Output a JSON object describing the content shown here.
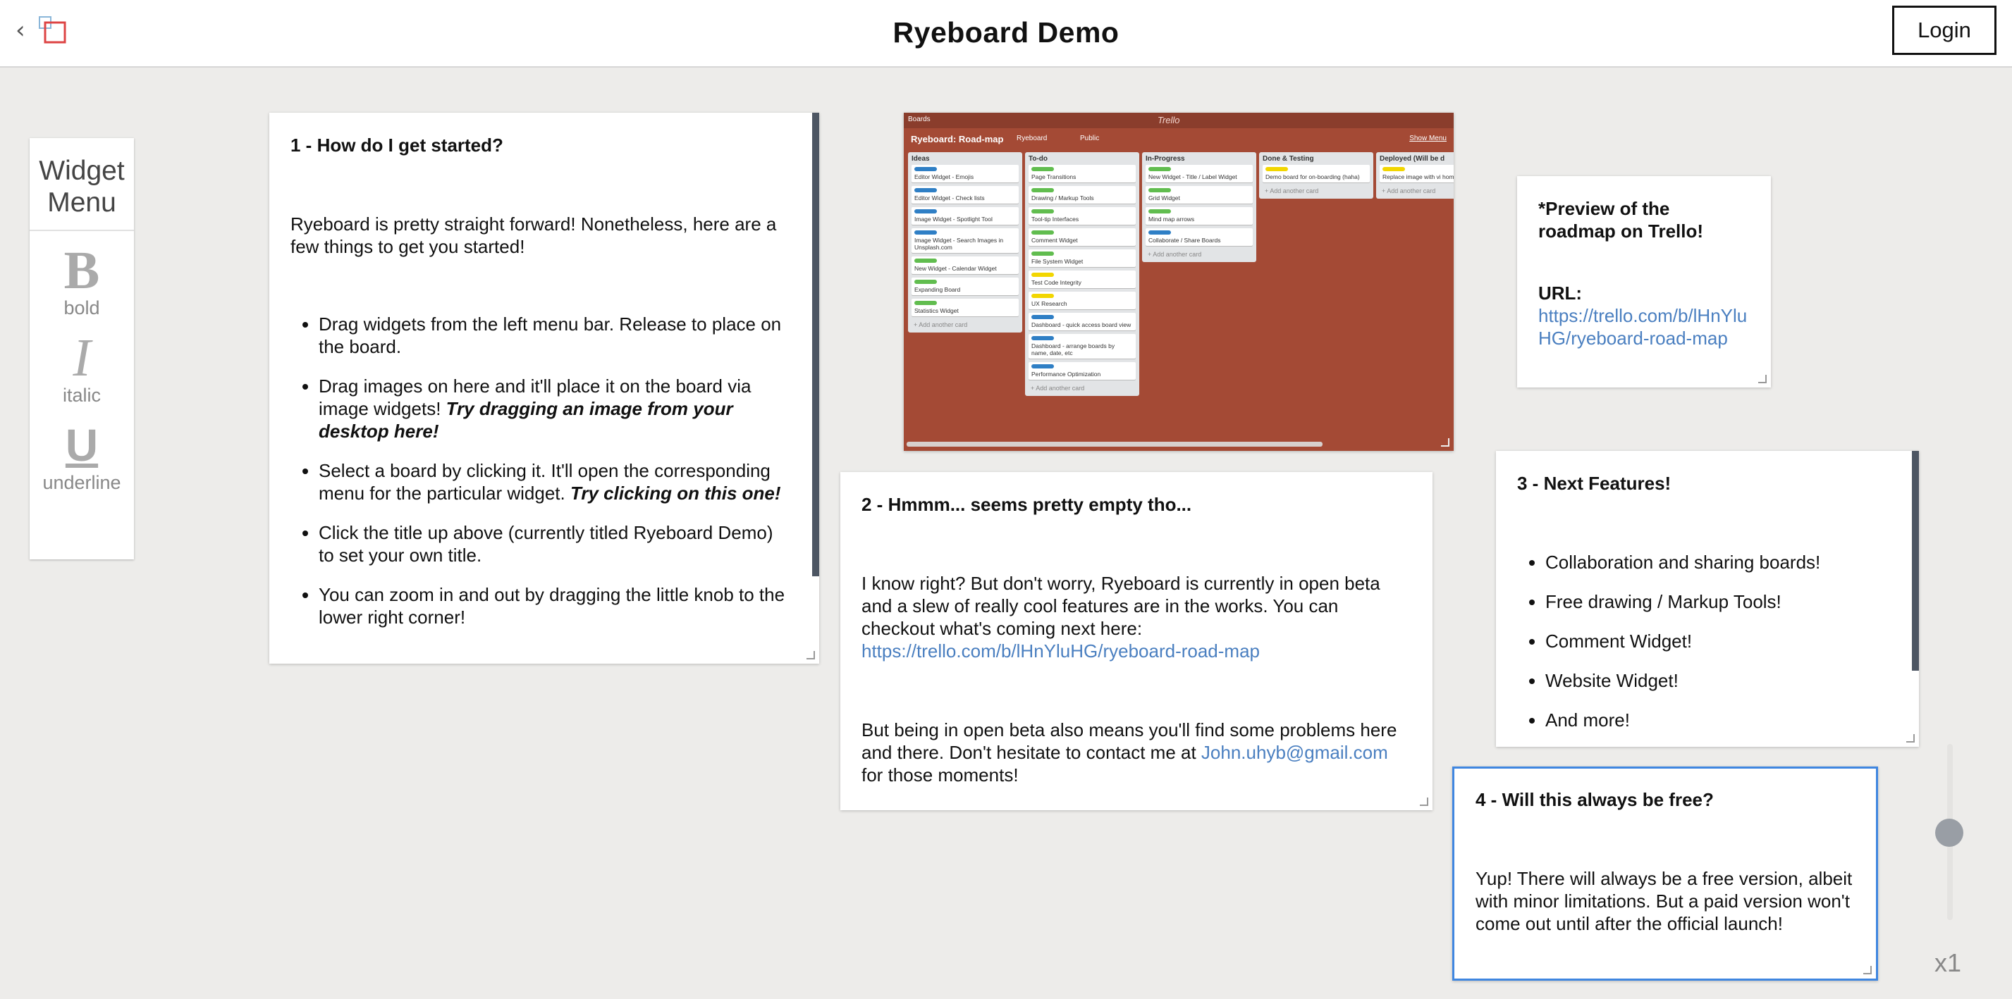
{
  "header": {
    "title": "Ryeboard Demo",
    "login_label": "Login",
    "back_icon": "chevron-left-icon",
    "logo_icon": "ryeboard-logo-icon"
  },
  "widget_menu": {
    "title": "Widget Menu",
    "tools": [
      {
        "glyph": "B",
        "label": "bold"
      },
      {
        "glyph": "I",
        "label": "italic"
      },
      {
        "glyph": "U",
        "label": "underline"
      }
    ]
  },
  "card1": {
    "heading": "1 - How do I get started?",
    "intro": "Ryeboard is pretty straight forward! Nonetheless, here are a few things to get you started!",
    "items": [
      {
        "text": "Drag widgets from the left menu bar. Release to place on the board.",
        "em": ""
      },
      {
        "text": "Drag images on here and it'll place it on the board via image widgets! ",
        "em": "Try dragging an image from your desktop here!"
      },
      {
        "text": "Select a board by clicking it. It'll open the corresponding menu for the particular widget. ",
        "em": "Try clicking on this one!"
      },
      {
        "text": "Click the title up above (currently titled Ryeboard Demo) to set your own title.",
        "em": ""
      },
      {
        "text": " You can zoom in and out by dragging the little knob to the lower right corner!",
        "em": ""
      }
    ]
  },
  "trello": {
    "boards_label": "Boards",
    "logo": "Trello",
    "board_name": "Ryeboard: Road-map",
    "team": "Ryeboard",
    "visibility": "Public",
    "show_menu": "Show Menu",
    "add_card": "+ Add another card",
    "lists": [
      {
        "title": "Ideas",
        "cards": [
          {
            "text": "Editor Widget - Emojis",
            "color": "#2f7fc5"
          },
          {
            "text": "Editor Widget - Check lists",
            "color": "#2f7fc5"
          },
          {
            "text": "Image Widget - Spotlight Tool",
            "color": "#2f7fc5"
          },
          {
            "text": "Image Widget - Search Images in Unsplash.com",
            "color": "#2f7fc5"
          },
          {
            "text": "New Widget - Calendar Widget",
            "color": "#61bd4f"
          },
          {
            "text": "Expanding Board",
            "color": "#61bd4f"
          },
          {
            "text": "Statistics Widget",
            "color": "#61bd4f"
          }
        ]
      },
      {
        "title": "To-do",
        "cards": [
          {
            "text": "Page Transitions",
            "color": "#61bd4f"
          },
          {
            "text": "Drawing / Markup Tools",
            "color": "#61bd4f"
          },
          {
            "text": "Tool-tip Interfaces",
            "color": "#61bd4f"
          },
          {
            "text": "Comment Widget",
            "color": "#61bd4f"
          },
          {
            "text": "File System Widget",
            "color": "#61bd4f"
          },
          {
            "text": "Test Code Integrity",
            "color": "#f2d600"
          },
          {
            "text": "UX Research",
            "color": "#f2d600"
          },
          {
            "text": "Dashboard - quick access board view",
            "color": "#2f7fc5"
          },
          {
            "text": "Dashboard - arrange boards by name, date, etc",
            "color": "#2f7fc5"
          },
          {
            "text": "Performance Optimization",
            "color": "#2f7fc5"
          }
        ]
      },
      {
        "title": "In-Progress",
        "cards": [
          {
            "text": "New Widget - Title / Label Widget",
            "color": "#61bd4f"
          },
          {
            "text": "Grid Widget",
            "color": "#61bd4f"
          },
          {
            "text": "Mind map arrows",
            "color": "#61bd4f"
          },
          {
            "text": "Collaborate / Share Boards",
            "color": "#2f7fc5"
          }
        ]
      },
      {
        "title": "Done & Testing",
        "cards": [
          {
            "text": "Demo board for on-boarding (haha)",
            "color": "#f2d600"
          }
        ]
      },
      {
        "title": "Deployed (Will be d",
        "cards": [
          {
            "text": "Replace image with vi homepage",
            "color": "#f2d600"
          }
        ]
      }
    ]
  },
  "preview": {
    "heading": "*Preview of the roadmap on Trello!",
    "url_label": "URL:",
    "url": "https://trello.com/b/lHnYluHG/ryeboard-road-map"
  },
  "card2": {
    "heading": "2 - Hmmm... seems pretty empty tho...",
    "p1": "I know right? But don't worry, Ryeboard is currently in open beta and a slew of really cool features are in the works. You can checkout what's coming next here: ",
    "p1_link": "https://trello.com/b/lHnYluHG/ryeboard-road-map",
    "p2_a": "But being in open beta also means you'll find some problems here and there. Don't hesitate to contact me at ",
    "p2_link": "John.uhyb@gmail.com",
    "p2_b": " for those moments!"
  },
  "card3": {
    "heading": "3 - Next Features!",
    "items": [
      "Collaboration and sharing boards!",
      "Free drawing / Markup Tools!",
      "Comment Widget!",
      "Website Widget!",
      "And more!"
    ]
  },
  "card4": {
    "heading": "4 - Will this always be free?",
    "body": "Yup! There will always be a free version, albeit with minor limitations. But a paid version won't come out until after the official launch!"
  },
  "zoom": {
    "label": "x1",
    "level": 1
  }
}
